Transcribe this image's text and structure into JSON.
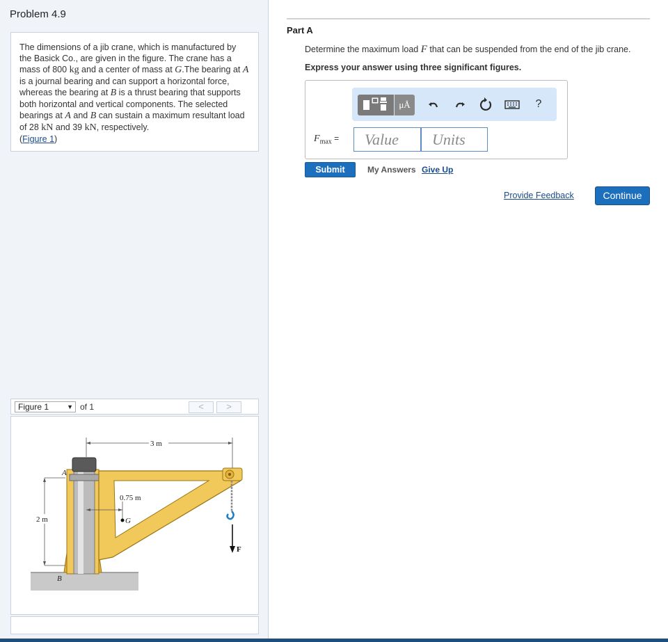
{
  "problem": {
    "title": "Problem 4.9",
    "intro": {
      "t1": "The dimensions of a jib crane, which is manufactured by the Basick Co., are given in the figure. The crane has a mass of 800 ",
      "u1": "kg",
      "t2": " and a center of mass at ",
      "s1": "G",
      "t3": ".The bearing at ",
      "s2": "A",
      "t4": " is a journal bearing and can support a horizontal force, whereas the bearing at ",
      "s3": "B",
      "t5": " is a thrust bearing that supports both horizontal and vertical components. The selected bearings at ",
      "s4": "A",
      "t6": " and ",
      "s5": "B",
      "t7": " can sustain a maximum resultant load of 28 ",
      "u2": "kN",
      "t8": " and 39 ",
      "u3": "kN",
      "t9": ", respectively.",
      "figure_link_open": "(",
      "figure_link": "Figure 1",
      "figure_link_close": ")"
    }
  },
  "figure_nav": {
    "selected": "Figure 1",
    "of_text": "of 1",
    "prev": "<",
    "next": ">"
  },
  "figure": {
    "dim_top": "3 m",
    "dim_left": "2 m",
    "dim_mid": "0.75 m",
    "label_A": "A",
    "label_B": "B",
    "label_G": "G",
    "label_F": "F"
  },
  "part": {
    "label": "Part A",
    "question_pre": "Determine the maximum load ",
    "question_sym": "F",
    "question_post": " that can be suspended from the end of the jib crane.",
    "instruction": "Express your answer using three significant figures."
  },
  "answer": {
    "var": "F",
    "sub": "max",
    "eq": " =",
    "value_placeholder": "Value",
    "units_placeholder": "Units",
    "toolbar": {
      "units_icon": "μÅ",
      "help_icon": "?"
    }
  },
  "actions": {
    "submit": "Submit",
    "my_answers": "My Answers",
    "give_up": "Give Up",
    "feedback": "Provide Feedback",
    "continue": "Continue"
  }
}
